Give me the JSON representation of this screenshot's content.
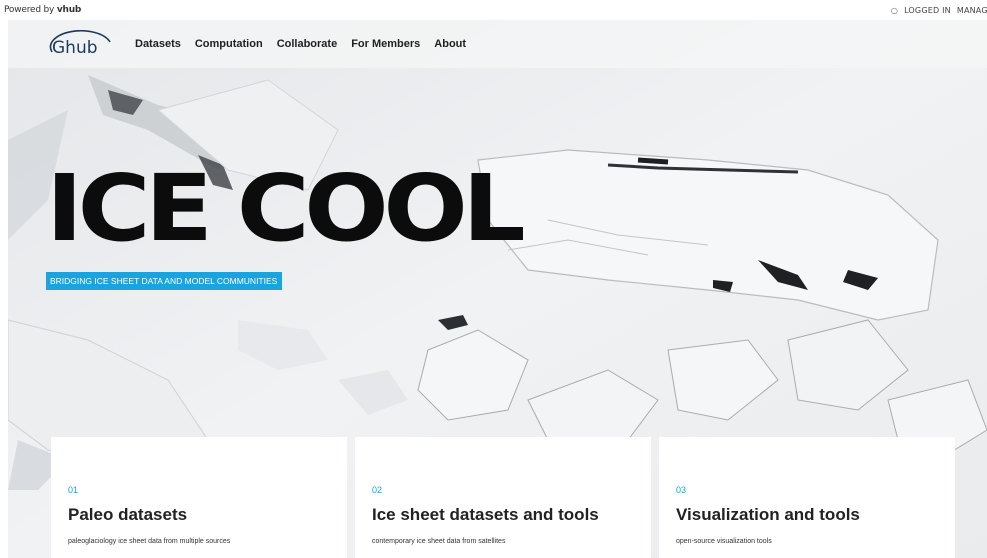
{
  "topbar": {
    "powered_prefix": "Powered by",
    "powered_brand": "vhub",
    "logged_in": "LOGGED IN",
    "manage": "MANAGE"
  },
  "nav": {
    "logo_text": "Ghub",
    "items": [
      "Datasets",
      "Computation",
      "Collaborate",
      "For Members",
      "About"
    ]
  },
  "hero": {
    "title": "ICE COOL",
    "tagline": "BRIDGING ICE SHEET DATA AND MODEL COMMUNITIES"
  },
  "cards": [
    {
      "number": "01",
      "title": "Paleo datasets",
      "description": "paleoglaciology ice sheet data from multiple sources"
    },
    {
      "number": "02",
      "title": "Ice sheet datasets and tools",
      "description": "contemporary ice sheet data from satellites"
    },
    {
      "number": "03",
      "title": "Visualization and tools",
      "description": "open-source visualization tools"
    }
  ],
  "colors": {
    "accent": "#1aa3dd",
    "title": "#0c0c0c",
    "ice_background": "#eef0f2"
  },
  "icons": {
    "lock": "lock-icon"
  }
}
